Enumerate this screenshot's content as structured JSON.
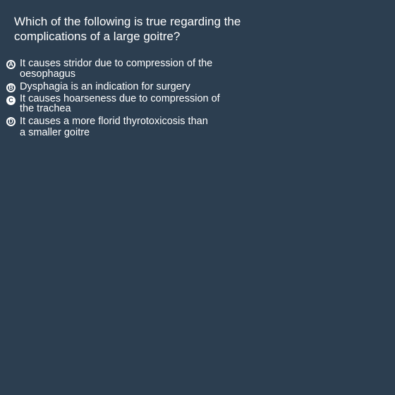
{
  "question": {
    "text": "Which of the following is true regarding the complications of a large goitre?"
  },
  "options": [
    {
      "letter": "A",
      "text": "It causes stridor due to compression of the oesophagus",
      "selected": false
    },
    {
      "letter": "B",
      "text": "Dysphagia is an indication for surgery",
      "selected": false
    },
    {
      "letter": "C",
      "text": "It causes hoarseness due to compression of the trachea",
      "selected": true
    },
    {
      "letter": "D",
      "text": "It causes a more florid thyrotoxicosis than a smaller goitre",
      "selected": false
    }
  ],
  "colors": {
    "background": "#2c3e50",
    "text": "#ffffff"
  }
}
